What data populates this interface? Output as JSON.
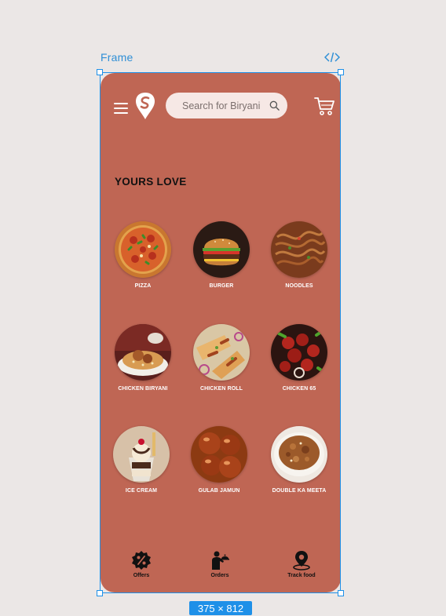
{
  "canvas": {
    "frame_label": "Frame",
    "size_badge": "375 × 812",
    "code_icon": "code-icon"
  },
  "header": {
    "menu_icon": "hamburger-menu-icon",
    "logo": "swiggy-logo",
    "search": {
      "placeholder": "Search for Biryani",
      "value": "",
      "icon": "search-icon"
    },
    "cart_icon": "cart-icon"
  },
  "section": {
    "title": "YOURS LOVE"
  },
  "dishes": [
    {
      "label": "PIZZA"
    },
    {
      "label": "BURGER"
    },
    {
      "label": "NOODLES"
    },
    {
      "label": "CHICKEN BIRYANI"
    },
    {
      "label": "CHICKEN ROLL"
    },
    {
      "label": "CHICKEN 65"
    },
    {
      "label": "ICE CREAM"
    },
    {
      "label": "GULAB JAMUN"
    },
    {
      "label": "DOUBLE KA MEETA"
    }
  ],
  "bottom_nav": [
    {
      "label": "Offers",
      "icon": "offers-percent-icon"
    },
    {
      "label": "Orders",
      "icon": "waiter-icon"
    },
    {
      "label": "Track food",
      "icon": "location-pin-icon"
    }
  ],
  "colors": {
    "background": "#ebe7e6",
    "phone": "#bf6654",
    "selection": "#1e90e8",
    "search_bg": "#f6e8e5",
    "text_dark": "#111111",
    "text_light": "#ffffff"
  }
}
